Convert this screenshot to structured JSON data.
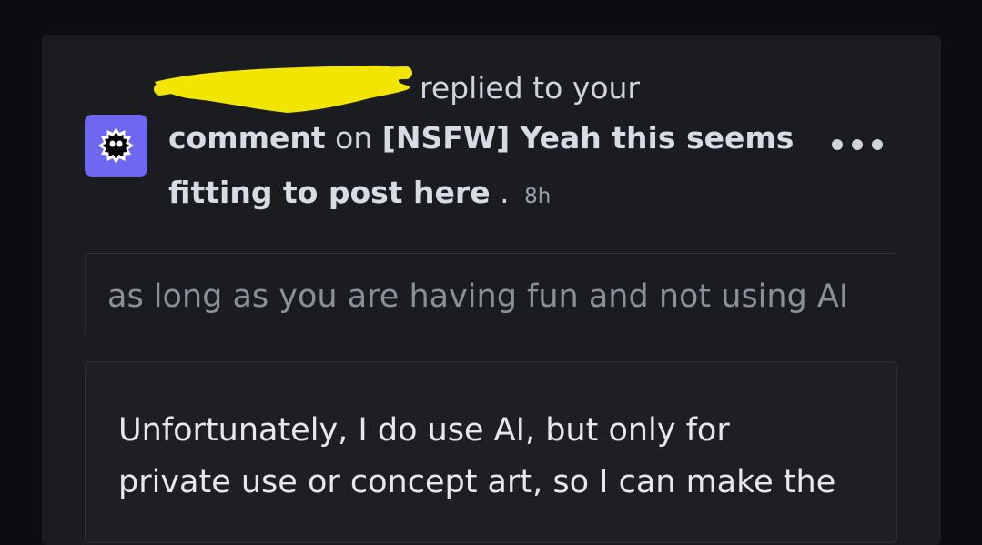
{
  "notification": {
    "replied_text": "replied to your",
    "comment_word": "comment",
    "on_word": "on",
    "post_title": "[NSFW] Yeah this seems fitting to post here",
    "post_title_line1": "[NSFW] Yeah this seems",
    "post_title_line2": "fitting to post here",
    "separator": ".",
    "timestamp": "8h",
    "avatar_icon": "snoo-monster-icon",
    "menu_icon": "more-options-icon",
    "accent_color": "#6e67f2"
  },
  "quoted_comment": {
    "text": "as long as you are having fun and not using AI"
  },
  "reply": {
    "lines": [
      "Unfortunately, I do use AI, but only for",
      "private use or concept art, so I can make the"
    ]
  }
}
